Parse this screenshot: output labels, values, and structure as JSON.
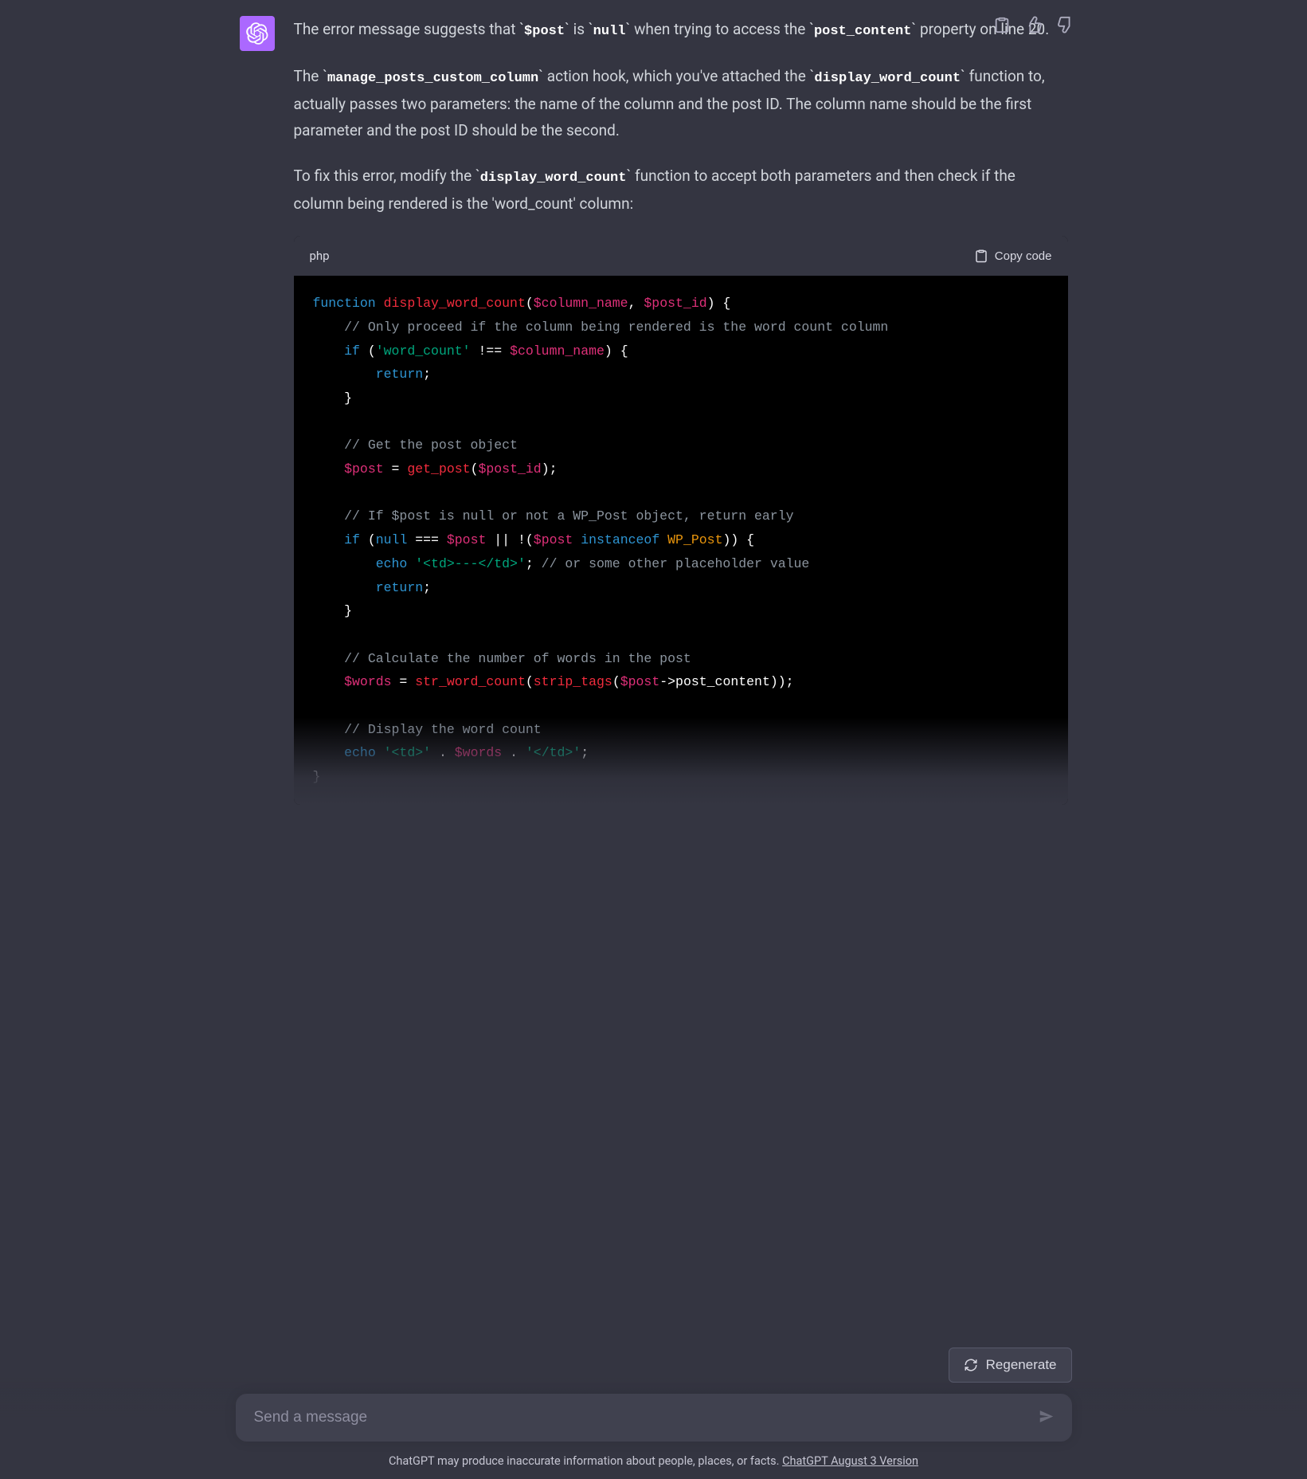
{
  "message": {
    "p1_parts": [
      {
        "t": "text",
        "v": "The error message suggests that "
      },
      {
        "t": "code",
        "v": "$post"
      },
      {
        "t": "text",
        "v": " is "
      },
      {
        "t": "code",
        "v": "null"
      },
      {
        "t": "text",
        "v": " when trying to access the "
      },
      {
        "t": "code",
        "v": "post_content"
      },
      {
        "t": "text",
        "v": " property on line 20."
      }
    ],
    "p2_parts": [
      {
        "t": "text",
        "v": "The "
      },
      {
        "t": "code",
        "v": "manage_posts_custom_column"
      },
      {
        "t": "text",
        "v": " action hook, which you've attached the "
      },
      {
        "t": "code",
        "v": "display_word_count"
      },
      {
        "t": "text",
        "v": " function to, actually passes two parameters: the name of the column and the post ID. The column name should be the first parameter and the post ID should be the second."
      }
    ],
    "p3_parts": [
      {
        "t": "text",
        "v": "To fix this error, modify the "
      },
      {
        "t": "code",
        "v": "display_word_count"
      },
      {
        "t": "text",
        "v": " function to accept both parameters and then check if the column being rendered is the 'word_count' column:"
      }
    ]
  },
  "code_block": {
    "language": "php",
    "copy_label": "Copy code",
    "tokens": [
      [
        {
          "c": "kw",
          "v": "function"
        },
        {
          "c": "punct",
          "v": " "
        },
        {
          "c": "fn",
          "v": "display_word_count"
        },
        {
          "c": "punct",
          "v": "("
        },
        {
          "c": "var",
          "v": "$column_name"
        },
        {
          "c": "punct",
          "v": ", "
        },
        {
          "c": "var",
          "v": "$post_id"
        },
        {
          "c": "punct",
          "v": ") {"
        }
      ],
      [
        {
          "c": "punct",
          "v": "    "
        },
        {
          "c": "cmt",
          "v": "// Only proceed if the column being rendered is the word count column"
        }
      ],
      [
        {
          "c": "punct",
          "v": "    "
        },
        {
          "c": "kw",
          "v": "if"
        },
        {
          "c": "punct",
          "v": " ("
        },
        {
          "c": "str",
          "v": "'word_count'"
        },
        {
          "c": "punct",
          "v": " !== "
        },
        {
          "c": "var",
          "v": "$column_name"
        },
        {
          "c": "punct",
          "v": ") {"
        }
      ],
      [
        {
          "c": "punct",
          "v": "        "
        },
        {
          "c": "kw",
          "v": "return"
        },
        {
          "c": "punct",
          "v": ";"
        }
      ],
      [
        {
          "c": "punct",
          "v": "    }"
        }
      ],
      [
        {
          "c": "punct",
          "v": ""
        }
      ],
      [
        {
          "c": "punct",
          "v": "    "
        },
        {
          "c": "cmt",
          "v": "// Get the post object"
        }
      ],
      [
        {
          "c": "punct",
          "v": "    "
        },
        {
          "c": "var",
          "v": "$post"
        },
        {
          "c": "punct",
          "v": " = "
        },
        {
          "c": "fn",
          "v": "get_post"
        },
        {
          "c": "punct",
          "v": "("
        },
        {
          "c": "var",
          "v": "$post_id"
        },
        {
          "c": "punct",
          "v": ");"
        }
      ],
      [
        {
          "c": "punct",
          "v": ""
        }
      ],
      [
        {
          "c": "punct",
          "v": "    "
        },
        {
          "c": "cmt",
          "v": "// If $post is null or not a WP_Post object, return early"
        }
      ],
      [
        {
          "c": "punct",
          "v": "    "
        },
        {
          "c": "kw",
          "v": "if"
        },
        {
          "c": "punct",
          "v": " ("
        },
        {
          "c": "kw",
          "v": "null"
        },
        {
          "c": "punct",
          "v": " === "
        },
        {
          "c": "var",
          "v": "$post"
        },
        {
          "c": "punct",
          "v": " || !("
        },
        {
          "c": "var",
          "v": "$post"
        },
        {
          "c": "punct",
          "v": " "
        },
        {
          "c": "kw",
          "v": "instanceof"
        },
        {
          "c": "punct",
          "v": " "
        },
        {
          "c": "cls",
          "v": "WP_Post"
        },
        {
          "c": "punct",
          "v": ")) {"
        }
      ],
      [
        {
          "c": "punct",
          "v": "        "
        },
        {
          "c": "kw",
          "v": "echo"
        },
        {
          "c": "punct",
          "v": " "
        },
        {
          "c": "str",
          "v": "'<td>---</td>'"
        },
        {
          "c": "punct",
          "v": "; "
        },
        {
          "c": "cmt",
          "v": "// or some other placeholder value"
        }
      ],
      [
        {
          "c": "punct",
          "v": "        "
        },
        {
          "c": "kw",
          "v": "return"
        },
        {
          "c": "punct",
          "v": ";"
        }
      ],
      [
        {
          "c": "punct",
          "v": "    }"
        }
      ],
      [
        {
          "c": "punct",
          "v": ""
        }
      ],
      [
        {
          "c": "punct",
          "v": "    "
        },
        {
          "c": "cmt",
          "v": "// Calculate the number of words in the post"
        }
      ],
      [
        {
          "c": "punct",
          "v": "    "
        },
        {
          "c": "var",
          "v": "$words"
        },
        {
          "c": "punct",
          "v": " = "
        },
        {
          "c": "fn",
          "v": "str_word_count"
        },
        {
          "c": "punct",
          "v": "("
        },
        {
          "c": "fn",
          "v": "strip_tags"
        },
        {
          "c": "punct",
          "v": "("
        },
        {
          "c": "var",
          "v": "$post"
        },
        {
          "c": "punct",
          "v": "->post_content));"
        }
      ],
      [
        {
          "c": "punct",
          "v": ""
        }
      ],
      [
        {
          "c": "punct",
          "v": "    "
        },
        {
          "c": "cmt",
          "v": "// Display the word count"
        }
      ],
      [
        {
          "c": "punct",
          "v": "    "
        },
        {
          "c": "kw",
          "v": "echo"
        },
        {
          "c": "punct",
          "v": " "
        },
        {
          "c": "str",
          "v": "'<td>'"
        },
        {
          "c": "punct",
          "v": " . "
        },
        {
          "c": "var",
          "v": "$words"
        },
        {
          "c": "punct",
          "v": " . "
        },
        {
          "c": "str",
          "v": "'</td>'"
        },
        {
          "c": "punct",
          "v": ";"
        }
      ],
      [
        {
          "c": "punct",
          "v": "}"
        }
      ]
    ]
  },
  "controls": {
    "regenerate_label": "Regenerate",
    "input_placeholder": "Send a message"
  },
  "footer": {
    "disclaimer_text": "ChatGPT may produce inaccurate information about people, places, or facts. ",
    "version_link": "ChatGPT August 3 Version"
  }
}
